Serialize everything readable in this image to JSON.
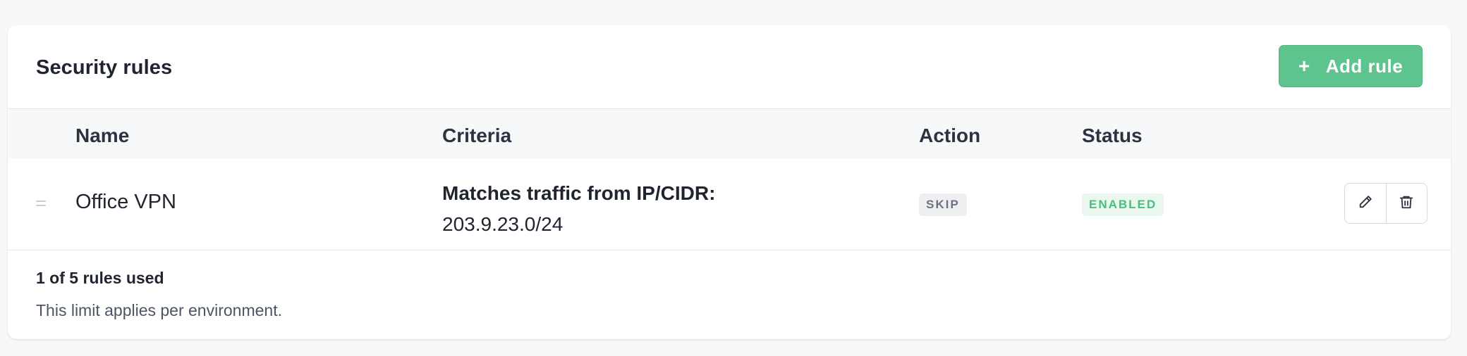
{
  "header": {
    "title": "Security rules",
    "add_button_icon": "+",
    "add_button_label": "Add rule"
  },
  "table": {
    "columns": [
      "Name",
      "Criteria",
      "Action",
      "Status"
    ],
    "rows": [
      {
        "name": "Office VPN",
        "criteria_label": "Matches traffic from IP/CIDR:",
        "criteria_value": "203.9.23.0/24",
        "action": "SKIP",
        "status": "ENABLED"
      }
    ]
  },
  "footer": {
    "usage": "1 of 5 rules used",
    "note": "This limit applies per environment."
  },
  "colors": {
    "accent": "#5ec48d",
    "enabled_text": "#47c07e",
    "enabled_bg": "#e9f7ef",
    "skip_bg": "#eeeff1",
    "skip_text": "#6b7280"
  }
}
